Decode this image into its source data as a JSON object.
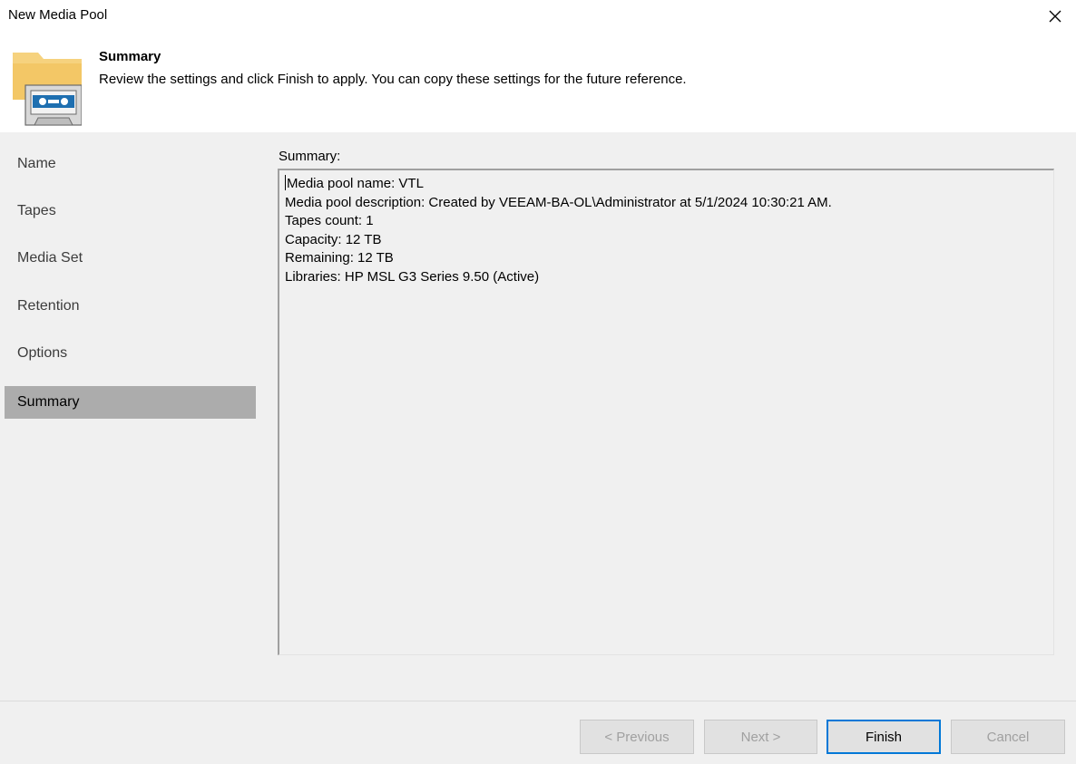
{
  "window": {
    "title": "New Media Pool"
  },
  "header": {
    "title": "Summary",
    "description": "Review the settings and click Finish to apply. You can copy these settings for the future reference."
  },
  "sidebar": {
    "items": [
      {
        "label": "Name",
        "active": false
      },
      {
        "label": "Tapes",
        "active": false
      },
      {
        "label": "Media Set",
        "active": false
      },
      {
        "label": "Retention",
        "active": false
      },
      {
        "label": "Options",
        "active": false
      },
      {
        "label": "Summary",
        "active": true
      }
    ]
  },
  "main": {
    "summary_label": "Summary:",
    "summary_lines": [
      "Media pool name: VTL",
      "Media pool description: Created by VEEAM-BA-OL\\Administrator at 5/1/2024 10:30:21 AM.",
      "Tapes count: 1",
      "Capacity: 12 TB",
      "Remaining: 12 TB",
      "Libraries: HP MSL G3 Series 9.50 (Active)"
    ]
  },
  "footer": {
    "previous_label": "< Previous",
    "next_label": "Next >",
    "finish_label": "Finish",
    "cancel_label": "Cancel"
  },
  "icons": {
    "close": "close-icon",
    "header": "folder-tape-icon"
  },
  "colors": {
    "accent": "#0078d7",
    "active_nav": "#acacac",
    "panel": "#f0f0f0"
  }
}
